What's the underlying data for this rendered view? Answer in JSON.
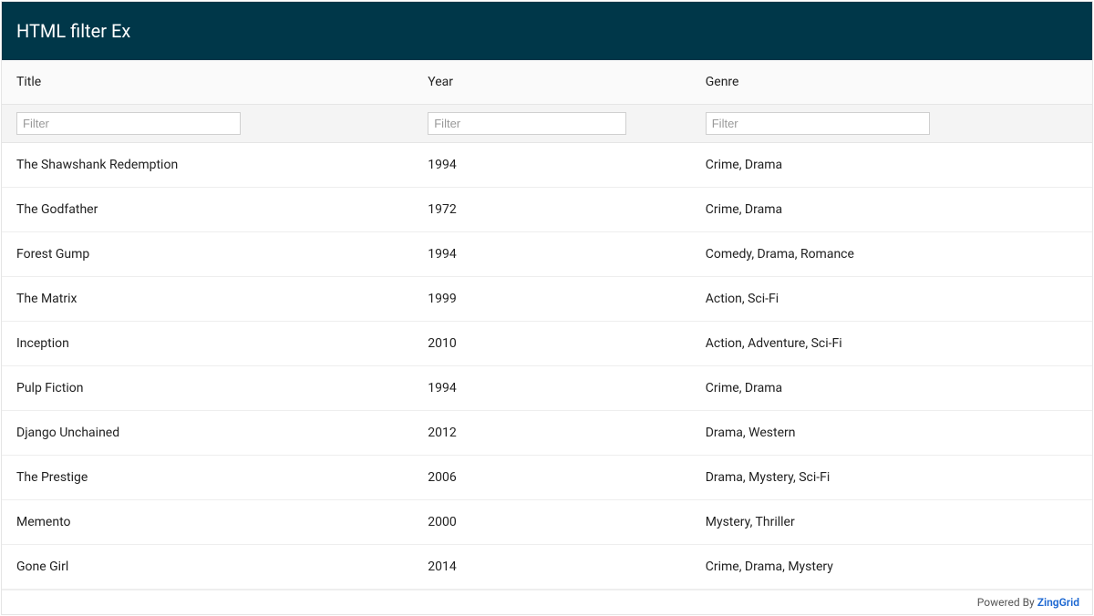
{
  "caption": "HTML filter Ex",
  "columns": [
    {
      "label": "Title"
    },
    {
      "label": "Year"
    },
    {
      "label": "Genre"
    }
  ],
  "filter_placeholder": "Filter",
  "rows": [
    {
      "title": "The Shawshank Redemption",
      "year": "1994",
      "genre": "Crime, Drama"
    },
    {
      "title": "The Godfather",
      "year": "1972",
      "genre": "Crime, Drama"
    },
    {
      "title": "Forest Gump",
      "year": "1994",
      "genre": "Comedy, Drama, Romance"
    },
    {
      "title": "The Matrix",
      "year": "1999",
      "genre": "Action, Sci-Fi"
    },
    {
      "title": "Inception",
      "year": "2010",
      "genre": "Action, Adventure, Sci-Fi"
    },
    {
      "title": "Pulp Fiction",
      "year": "1994",
      "genre": "Crime, Drama"
    },
    {
      "title": "Django Unchained",
      "year": "2012",
      "genre": "Drama, Western"
    },
    {
      "title": "The Prestige",
      "year": "2006",
      "genre": "Drama, Mystery, Sci-Fi"
    },
    {
      "title": "Memento",
      "year": "2000",
      "genre": "Mystery, Thriller"
    },
    {
      "title": "Gone Girl",
      "year": "2014",
      "genre": "Crime, Drama, Mystery"
    }
  ],
  "footer": {
    "prefix": "Powered By ",
    "brand": "ZingGrid"
  }
}
